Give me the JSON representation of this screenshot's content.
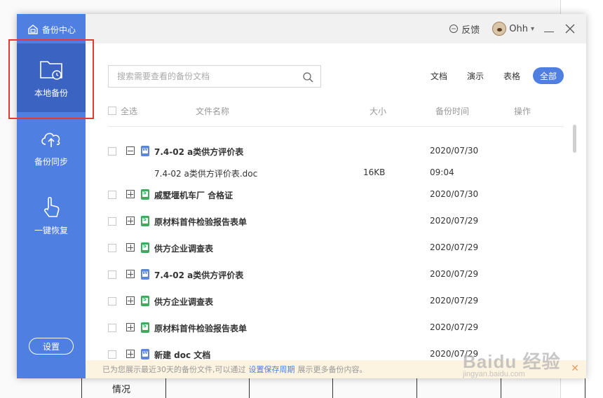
{
  "background": {
    "cell_text": "情况"
  },
  "sidebar": {
    "brand": "备份中心",
    "items": [
      {
        "label": "本地备份",
        "active": true
      },
      {
        "label": "备份同步",
        "active": false
      },
      {
        "label": "一键恢复",
        "active": false
      }
    ],
    "settings_label": "设置"
  },
  "topbar": {
    "feedback": "反馈",
    "username": "Ohh"
  },
  "search": {
    "placeholder": "搜索需要查看的备份文档"
  },
  "filters": [
    "文档",
    "演示",
    "表格",
    "全部"
  ],
  "active_filter": "全部",
  "table": {
    "headers": {
      "select_all": "全选",
      "name": "文件名称",
      "size": "大小",
      "time": "备份时间",
      "actions": "操作"
    },
    "rows": [
      {
        "type": "group",
        "expanded": true,
        "icon": "word-doc-icon",
        "name": "7.4-02  a类供方评价表",
        "time": "2020/07/30"
      },
      {
        "type": "child",
        "name": "7.4-02  a类供方评价表.doc",
        "size": "16KB",
        "time": "09:04"
      },
      {
        "type": "group",
        "expanded": false,
        "icon": "spreadsheet-icon",
        "name": "戚墅堰机车厂 合格证",
        "time": "2020/07/30"
      },
      {
        "type": "group",
        "expanded": false,
        "icon": "spreadsheet-icon",
        "name": "原材料首件检验报告表单",
        "time": "2020/07/29"
      },
      {
        "type": "group",
        "expanded": false,
        "icon": "spreadsheet-icon",
        "name": "供方企业调查表",
        "time": "2020/07/29"
      },
      {
        "type": "group",
        "expanded": false,
        "icon": "word-doc-icon",
        "name": "7.4-02  a类供方评价表",
        "time": "2020/07/29"
      },
      {
        "type": "group",
        "expanded": false,
        "icon": "spreadsheet-icon",
        "name": "供方企业调查表",
        "time": "2020/07/29"
      },
      {
        "type": "group",
        "expanded": false,
        "icon": "spreadsheet-icon",
        "name": "原材料首件检验报告表单",
        "time": "2020/07/29"
      },
      {
        "type": "group",
        "expanded": false,
        "icon": "word-doc-icon",
        "name": "新建 doc 文档",
        "time": "2020/07/29"
      }
    ]
  },
  "notice": {
    "prefix": "已为您展示最近30天的备份文件,可以通过",
    "link": "设置保存周期",
    "suffix": "展示更多备份内容。"
  },
  "watermark": {
    "text": "Baidu 经验",
    "sub": "jingyan.baidu.com"
  },
  "colors": {
    "accent": "#4f7fe0",
    "sidebar_active": "#3b63c2",
    "highlight": "#e53935",
    "notice_bg": "#fdf3e1"
  }
}
